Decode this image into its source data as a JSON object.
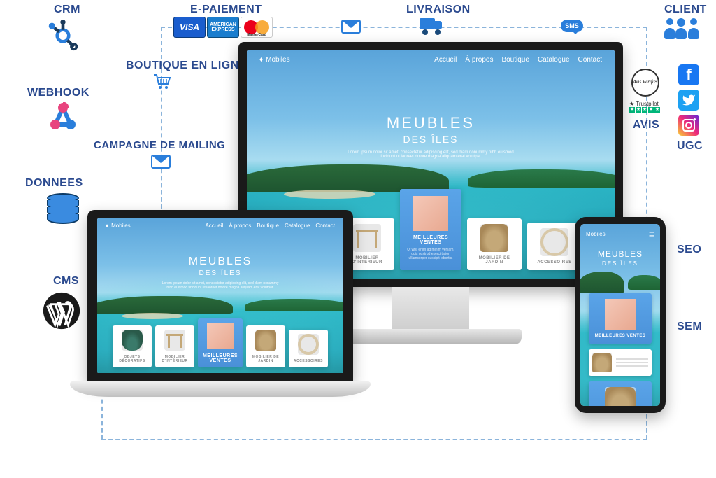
{
  "labels": {
    "crm": "CRM",
    "webhook": "WEBHOOK",
    "donnees": "DONNEES",
    "cms": "CMS",
    "epaiement": "E-PAIEMENT",
    "boutique": "BOUTIQUE EN LIGNE",
    "campagne": "CAMPAGNE DE MAILING",
    "livraison": "LIVRAISON",
    "client": "CLIENT",
    "avis": "AVIS",
    "ugc": "UGC",
    "seo": "SEO",
    "sem": "SEM"
  },
  "payment_cards": {
    "visa": "VISA",
    "amex": "AMERICAN EXPRESS",
    "mastercard": "MasterCard"
  },
  "sms": "SMS",
  "avis_badge": "Avis Vérifiés",
  "trustpilot": {
    "name": "★ Trustpilot"
  },
  "site": {
    "brand": "Mobiles",
    "nav": [
      "Accueil",
      "À propos",
      "Boutique",
      "Catalogue",
      "Contact"
    ],
    "hero_h1": "MEUBLES",
    "hero_h2": "DES ÎLES",
    "hero_p": "Lorem ipsum dolor sit amet, consectetur adipiscing elit, sed diam nonummy nibh euismod tincidunt ut laoreet dolore magna aliquam erat volutpat.",
    "categories": [
      {
        "title": "OBJETS DÉCORATIFS"
      },
      {
        "title": "MOBILIER D'INTÉRIEUR"
      },
      {
        "title": "MEILLEURES VENTES",
        "featured": true,
        "sub": "Ut wisi enim ad minim veniam, quis nostrud exerci tation ullamcorper suscipit lobortis."
      },
      {
        "title": "MOBILIER DE JARDIN"
      },
      {
        "title": "ACCESSOIRES"
      }
    ]
  }
}
